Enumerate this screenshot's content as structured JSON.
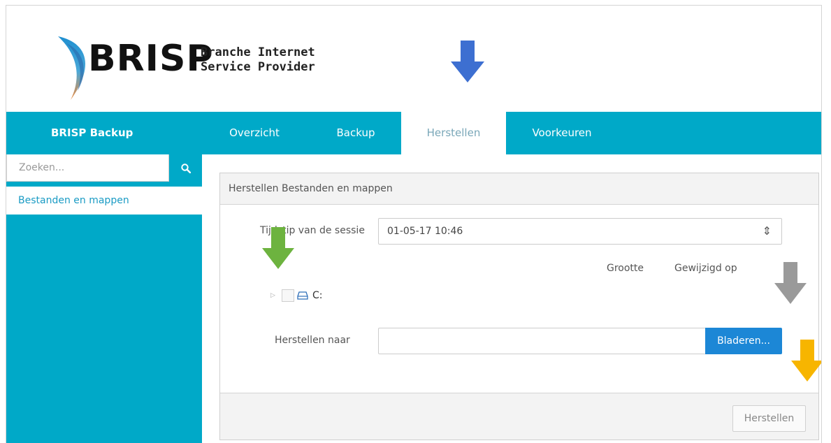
{
  "logo": {
    "word": "BRISP",
    "subtitle_line1": "Branche Internet",
    "subtitle_line2": "Service Provider"
  },
  "nav": {
    "brand": "BRISP Backup",
    "tabs": [
      {
        "label": "Overzicht",
        "active": false
      },
      {
        "label": "Backup",
        "active": false
      },
      {
        "label": "Herstellen",
        "active": true
      },
      {
        "label": "Voorkeuren",
        "active": false
      }
    ]
  },
  "sidebar": {
    "search_placeholder": "Zoeken...",
    "search_icon": "search-icon",
    "items": [
      {
        "label": "Bestanden en mappen",
        "selected": true
      }
    ]
  },
  "panel": {
    "title": "Herstellen Bestanden en mappen",
    "session_label": "Tijdstip van de sessie",
    "session_value": "01-05-17 10:46",
    "columns": {
      "size": "Grootte",
      "modified": "Gewijzigd op"
    },
    "tree": [
      {
        "label": "C:",
        "icon": "drive-icon"
      }
    ],
    "restore_to_label": "Herstellen naar",
    "restore_to_value": "",
    "browse_label": "Bladeren...",
    "restore_button": "Herstellen"
  },
  "colors": {
    "nav": "#00a9c8",
    "accent_button": "#1c87d6",
    "arrow_blue": "#3d6fd1",
    "arrow_green": "#6db33f",
    "arrow_gray": "#9a9a9a",
    "arrow_yellow": "#f7b500"
  }
}
